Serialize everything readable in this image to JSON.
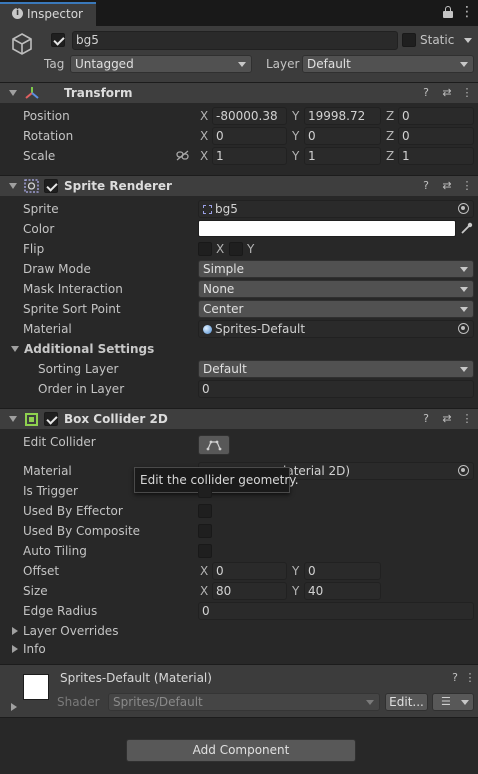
{
  "tab": {
    "label": "Inspector"
  },
  "object": {
    "name": "bg5",
    "static_label": "Static",
    "tag_label": "Tag",
    "tag_value": "Untagged",
    "layer_label": "Layer",
    "layer_value": "Default"
  },
  "transform": {
    "title": "Transform",
    "position_label": "Position",
    "rotation_label": "Rotation",
    "scale_label": "Scale",
    "axes": {
      "x": "X",
      "y": "Y",
      "z": "Z"
    },
    "position": {
      "x": "-80000.38",
      "y": "19998.72",
      "z": "0"
    },
    "rotation": {
      "x": "0",
      "y": "0",
      "z": "0"
    },
    "scale": {
      "x": "1",
      "y": "1",
      "z": "1"
    }
  },
  "sprite_renderer": {
    "title": "Sprite Renderer",
    "sprite_label": "Sprite",
    "sprite_value": "bg5",
    "color_label": "Color",
    "color_value": "#ffffff",
    "flip_label": "Flip",
    "flip_x": "X",
    "flip_y": "Y",
    "draw_mode_label": "Draw Mode",
    "draw_mode_value": "Simple",
    "mask_label": "Mask Interaction",
    "mask_value": "None",
    "sort_point_label": "Sprite Sort Point",
    "sort_point_value": "Center",
    "material_label": "Material",
    "material_value": "Sprites-Default",
    "additional_label": "Additional Settings",
    "sorting_layer_label": "Sorting Layer",
    "sorting_layer_value": "Default",
    "order_label": "Order in Layer",
    "order_value": "0"
  },
  "box_collider": {
    "title": "Box Collider 2D",
    "edit_label": "Edit Collider",
    "material_label": "Material",
    "material_value": "laterial 2D)",
    "tooltip": "Edit the collider geometry.",
    "is_trigger_label": "Is Trigger",
    "used_by_effector_label": "Used By Effector",
    "used_by_composite_label": "Used By Composite",
    "auto_tiling_label": "Auto Tiling",
    "offset_label": "Offset",
    "offset": {
      "x": "0",
      "y": "0"
    },
    "size_label": "Size",
    "size": {
      "x": "80",
      "y": "40"
    },
    "edge_radius_label": "Edge Radius",
    "edge_radius_value": "0",
    "layer_overrides_label": "Layer Overrides",
    "info_label": "Info"
  },
  "material_panel": {
    "title": "Sprites-Default (Material)",
    "shader_label": "Shader",
    "shader_value": "Sprites/Default",
    "edit_label": "Edit..."
  },
  "add_component_label": "Add Component",
  "colors": {
    "accent_checkbox": "#8fd14f",
    "panel": "#282828",
    "header": "#3e3e3e"
  }
}
